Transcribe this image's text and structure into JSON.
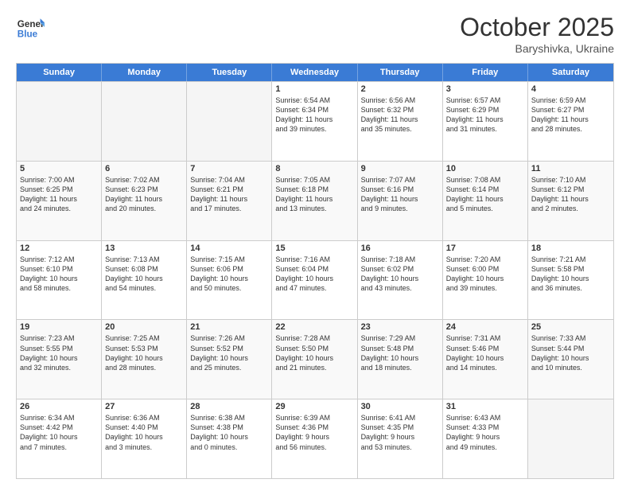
{
  "header": {
    "logo_general": "General",
    "logo_blue": "Blue",
    "month": "October 2025",
    "location": "Baryshivka, Ukraine"
  },
  "days_of_week": [
    "Sunday",
    "Monday",
    "Tuesday",
    "Wednesday",
    "Thursday",
    "Friday",
    "Saturday"
  ],
  "rows": [
    [
      {
        "day": "",
        "info": "",
        "empty": true
      },
      {
        "day": "",
        "info": "",
        "empty": true
      },
      {
        "day": "",
        "info": "",
        "empty": true
      },
      {
        "day": "1",
        "info": "Sunrise: 6:54 AM\nSunset: 6:34 PM\nDaylight: 11 hours\nand 39 minutes."
      },
      {
        "day": "2",
        "info": "Sunrise: 6:56 AM\nSunset: 6:32 PM\nDaylight: 11 hours\nand 35 minutes."
      },
      {
        "day": "3",
        "info": "Sunrise: 6:57 AM\nSunset: 6:29 PM\nDaylight: 11 hours\nand 31 minutes."
      },
      {
        "day": "4",
        "info": "Sunrise: 6:59 AM\nSunset: 6:27 PM\nDaylight: 11 hours\nand 28 minutes."
      }
    ],
    [
      {
        "day": "5",
        "info": "Sunrise: 7:00 AM\nSunset: 6:25 PM\nDaylight: 11 hours\nand 24 minutes."
      },
      {
        "day": "6",
        "info": "Sunrise: 7:02 AM\nSunset: 6:23 PM\nDaylight: 11 hours\nand 20 minutes."
      },
      {
        "day": "7",
        "info": "Sunrise: 7:04 AM\nSunset: 6:21 PM\nDaylight: 11 hours\nand 17 minutes."
      },
      {
        "day": "8",
        "info": "Sunrise: 7:05 AM\nSunset: 6:18 PM\nDaylight: 11 hours\nand 13 minutes."
      },
      {
        "day": "9",
        "info": "Sunrise: 7:07 AM\nSunset: 6:16 PM\nDaylight: 11 hours\nand 9 minutes."
      },
      {
        "day": "10",
        "info": "Sunrise: 7:08 AM\nSunset: 6:14 PM\nDaylight: 11 hours\nand 5 minutes."
      },
      {
        "day": "11",
        "info": "Sunrise: 7:10 AM\nSunset: 6:12 PM\nDaylight: 11 hours\nand 2 minutes."
      }
    ],
    [
      {
        "day": "12",
        "info": "Sunrise: 7:12 AM\nSunset: 6:10 PM\nDaylight: 10 hours\nand 58 minutes."
      },
      {
        "day": "13",
        "info": "Sunrise: 7:13 AM\nSunset: 6:08 PM\nDaylight: 10 hours\nand 54 minutes."
      },
      {
        "day": "14",
        "info": "Sunrise: 7:15 AM\nSunset: 6:06 PM\nDaylight: 10 hours\nand 50 minutes."
      },
      {
        "day": "15",
        "info": "Sunrise: 7:16 AM\nSunset: 6:04 PM\nDaylight: 10 hours\nand 47 minutes."
      },
      {
        "day": "16",
        "info": "Sunrise: 7:18 AM\nSunset: 6:02 PM\nDaylight: 10 hours\nand 43 minutes."
      },
      {
        "day": "17",
        "info": "Sunrise: 7:20 AM\nSunset: 6:00 PM\nDaylight: 10 hours\nand 39 minutes."
      },
      {
        "day": "18",
        "info": "Sunrise: 7:21 AM\nSunset: 5:58 PM\nDaylight: 10 hours\nand 36 minutes."
      }
    ],
    [
      {
        "day": "19",
        "info": "Sunrise: 7:23 AM\nSunset: 5:55 PM\nDaylight: 10 hours\nand 32 minutes."
      },
      {
        "day": "20",
        "info": "Sunrise: 7:25 AM\nSunset: 5:53 PM\nDaylight: 10 hours\nand 28 minutes."
      },
      {
        "day": "21",
        "info": "Sunrise: 7:26 AM\nSunset: 5:52 PM\nDaylight: 10 hours\nand 25 minutes."
      },
      {
        "day": "22",
        "info": "Sunrise: 7:28 AM\nSunset: 5:50 PM\nDaylight: 10 hours\nand 21 minutes."
      },
      {
        "day": "23",
        "info": "Sunrise: 7:29 AM\nSunset: 5:48 PM\nDaylight: 10 hours\nand 18 minutes."
      },
      {
        "day": "24",
        "info": "Sunrise: 7:31 AM\nSunset: 5:46 PM\nDaylight: 10 hours\nand 14 minutes."
      },
      {
        "day": "25",
        "info": "Sunrise: 7:33 AM\nSunset: 5:44 PM\nDaylight: 10 hours\nand 10 minutes."
      }
    ],
    [
      {
        "day": "26",
        "info": "Sunrise: 6:34 AM\nSunset: 4:42 PM\nDaylight: 10 hours\nand 7 minutes."
      },
      {
        "day": "27",
        "info": "Sunrise: 6:36 AM\nSunset: 4:40 PM\nDaylight: 10 hours\nand 3 minutes."
      },
      {
        "day": "28",
        "info": "Sunrise: 6:38 AM\nSunset: 4:38 PM\nDaylight: 10 hours\nand 0 minutes."
      },
      {
        "day": "29",
        "info": "Sunrise: 6:39 AM\nSunset: 4:36 PM\nDaylight: 9 hours\nand 56 minutes."
      },
      {
        "day": "30",
        "info": "Sunrise: 6:41 AM\nSunset: 4:35 PM\nDaylight: 9 hours\nand 53 minutes."
      },
      {
        "day": "31",
        "info": "Sunrise: 6:43 AM\nSunset: 4:33 PM\nDaylight: 9 hours\nand 49 minutes."
      },
      {
        "day": "",
        "info": "",
        "empty": true
      }
    ]
  ]
}
